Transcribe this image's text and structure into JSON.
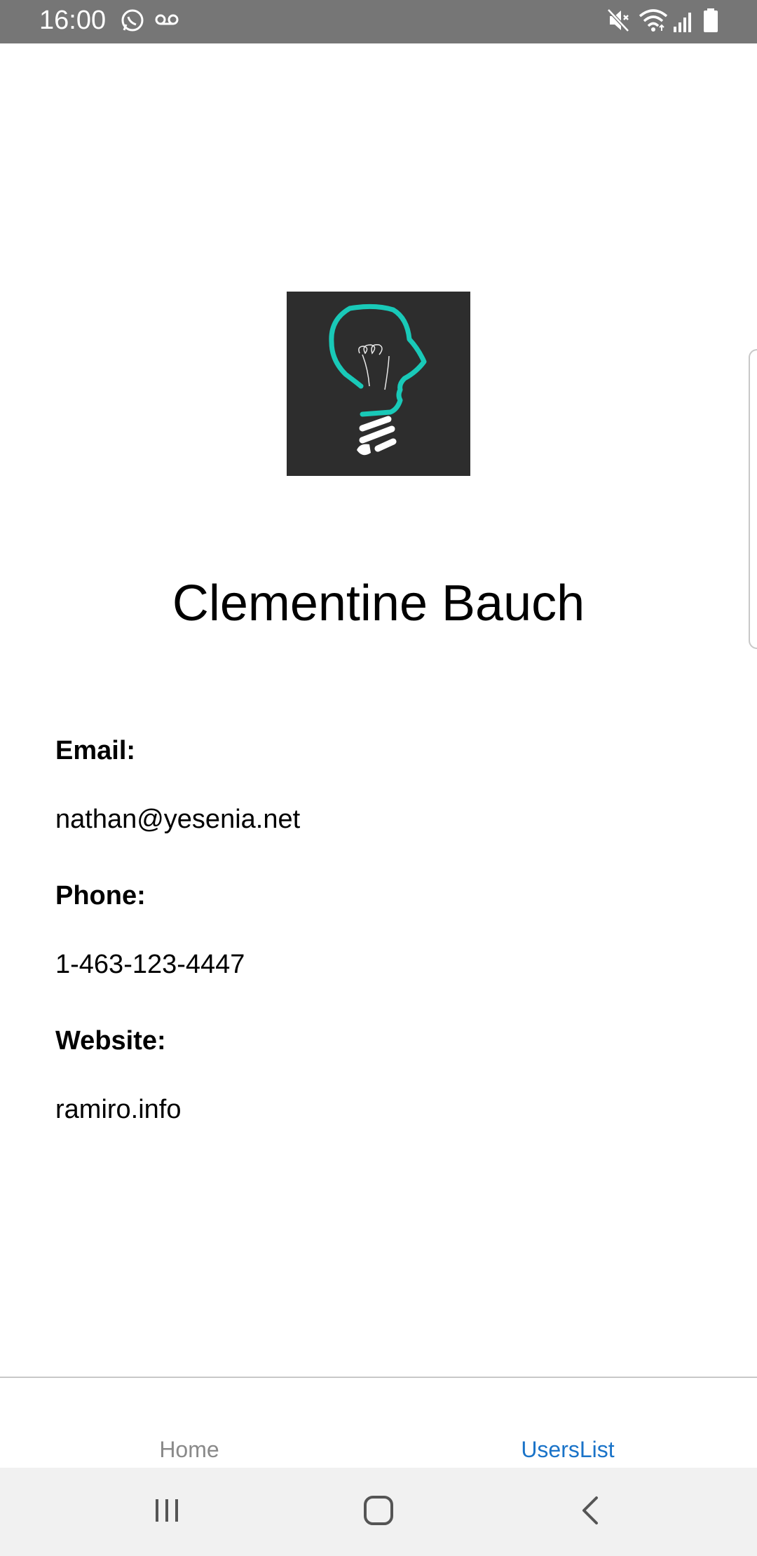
{
  "status_bar": {
    "time": "16:00",
    "icons": [
      "whatsapp-icon",
      "voicemail-icon",
      "mute-icon",
      "wifi-icon",
      "signal-icon",
      "battery-icon"
    ]
  },
  "profile": {
    "name": "Clementine Bauch",
    "email_label": "Email:",
    "email": "nathan@yesenia.net",
    "phone_label": "Phone:",
    "phone": "1-463-123-4447",
    "website_label": "Website:",
    "website": "ramiro.info"
  },
  "tabs": {
    "home_label": "Home",
    "users_label": "UsersList",
    "active": "UsersList"
  },
  "nav_bar": {
    "icons": [
      "recent-apps-icon",
      "home-icon",
      "back-icon"
    ]
  },
  "colors": {
    "status_bar": "#767676",
    "logo_bg": "#2d2d2d",
    "logo_accent": "#19c9b8",
    "active_tab": "#1a73c8",
    "inactive_tab": "#8a8a8a"
  }
}
